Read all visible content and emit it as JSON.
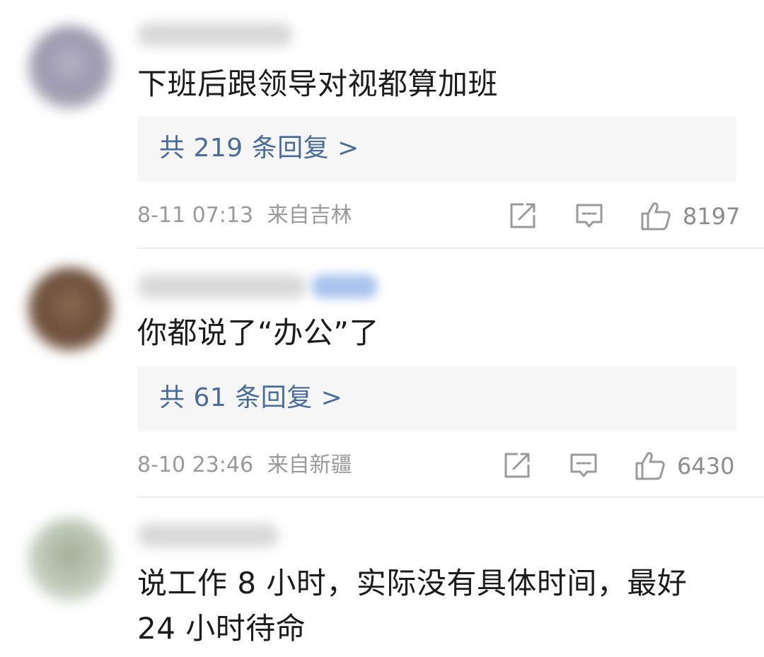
{
  "comments": [
    {
      "text": "下班后跟领导对视都算加班",
      "replies": "共 219 条回复 >",
      "time": "8-11 07:13",
      "location": "来自吉林",
      "likes": "8197",
      "avatar_color": "#a9a7b8"
    },
    {
      "text": "你都说了“办公”了",
      "replies": "共 61 条回复 >",
      "time": "8-10 23:46",
      "location": "来自新疆",
      "likes": "6430",
      "avatar_color": "#7a5b46"
    },
    {
      "text_line1": "说工作 8 小时，实际没有具体时间，最好",
      "text_line2": "24 小时待命",
      "avatar_color": "#b9c4b2"
    }
  ],
  "icons": {
    "share": "share-icon",
    "comment": "comment-icon",
    "like": "thumbs-up-icon"
  },
  "colors": {
    "link": "#4a6c9a",
    "meta": "#9a9a9a",
    "reply_bg": "#f6f6f6"
  }
}
